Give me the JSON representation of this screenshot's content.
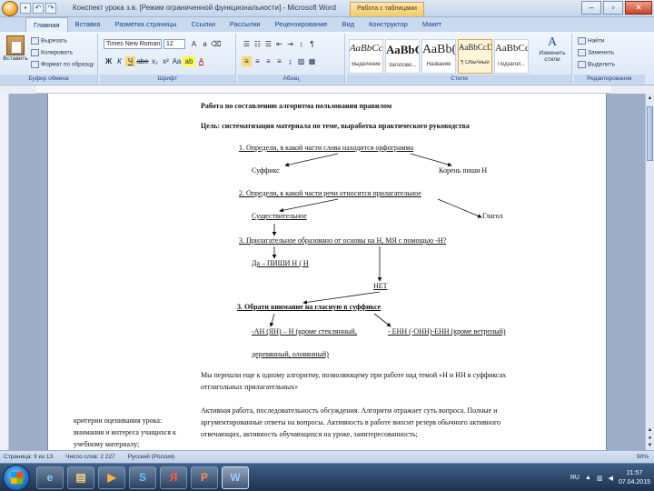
{
  "titlebar": {
    "title": "Конспект урока з.в. [Режим ограниченной функциональности] - Microsoft Word",
    "context_tab": "Работа с таблицами",
    "window_controls": [
      "–",
      "▫",
      "✕"
    ]
  },
  "ribbon_tabs": [
    "Главная",
    "Вставка",
    "Разметка страницы",
    "Ссылки",
    "Рассылки",
    "Рецензирование",
    "Вид",
    "Конструктор",
    "Макет"
  ],
  "ribbon": {
    "clipboard": {
      "paste": "Вставить",
      "cut": "Вырезать",
      "copy": "Копировать",
      "format_painter": "Формат по образцу",
      "label": "Буфер обмена"
    },
    "font": {
      "name": "Times New Roman",
      "size": "12",
      "label": "Шрифт",
      "buttons": [
        "Ж",
        "К",
        "Ч",
        "abe",
        "x₂",
        "x²",
        "Aa",
        "ab",
        "A"
      ]
    },
    "paragraph": {
      "label": "Абзац"
    },
    "styles": {
      "label": "Стили",
      "items": [
        {
          "sample": "АаВbСcI",
          "name": "Выделение"
        },
        {
          "sample": "АаBbC",
          "name": "Заголово..."
        },
        {
          "sample": "АаBb(",
          "name": "Название"
        },
        {
          "sample": "АаВbСcDc",
          "name": "¶ Обычный"
        },
        {
          "sample": "АаВbСcI",
          "name": "Подзагол..."
        }
      ],
      "change_styles": "Изменить стили"
    },
    "editing": {
      "find": "Найти",
      "replace": "Заменить",
      "select": "Выделить",
      "label": "Редактирование"
    }
  },
  "document": {
    "title": "Работа по составлению алгоритма пользования правилом",
    "goal": "Цель: систематизация материала по теме, выработка практического руководства",
    "step1": "1.   Определи, в какой части слова находится орфограмма",
    "step1_left": "Суффикс",
    "step1_right": "Корень     пиши Н",
    "step2": "2.   Определи, к какой части речи относится прилагательное",
    "step2_left": "Существительное",
    "step2_right": "Глагол",
    "step3": "3.   Прилагательное образовано от основы на Н, МЯ с помощью -Н?",
    "step3_answer": "Да – ПИШИ Н ( Н",
    "net": "НЕТ",
    "step4": "3. Обрати внимание на гласную в суффиксе",
    "rule_an": "-АН (ЯН) – Н (кроме стеклянный,",
    "rule_en": "- ЕНН (-ОНН)-ЕНН (кроме ветреный)",
    "rule_an2": "деревянный, оловянный)",
    "para1": "Мы перешли еще к одному алгоритму, позволяющему при работе над темой «Н и НН в суффиксах",
    "para1b": "отглагольных прилагательных»",
    "para2": "Активная работа, последовательность обсуждения. Алгоритм отражает суть вопроса. Полные и",
    "para2b": "аргументированные ответы на вопросы. Активность в работе вносит резерв обычного активного",
    "para2c": "отвечающих, активность обучающихся на уроке, заинтересованность;",
    "left_note1": "критерии оценивания урока:",
    "left_note2": "внимания и интереса учащихся к",
    "left_note3": "учебному материалу;"
  },
  "statusbar": {
    "page": "Страница: 9 из 13",
    "words": "Число слов: 2 227",
    "lang": "Русский (Россия)",
    "zoom": "90%"
  },
  "taskbar": {
    "lang": "RU",
    "time": "21:57",
    "date": "07.04.2015",
    "apps": [
      "IE",
      "Explorer",
      "Media",
      "Skype",
      "Yandex",
      "PowerPoint",
      "Word"
    ]
  }
}
